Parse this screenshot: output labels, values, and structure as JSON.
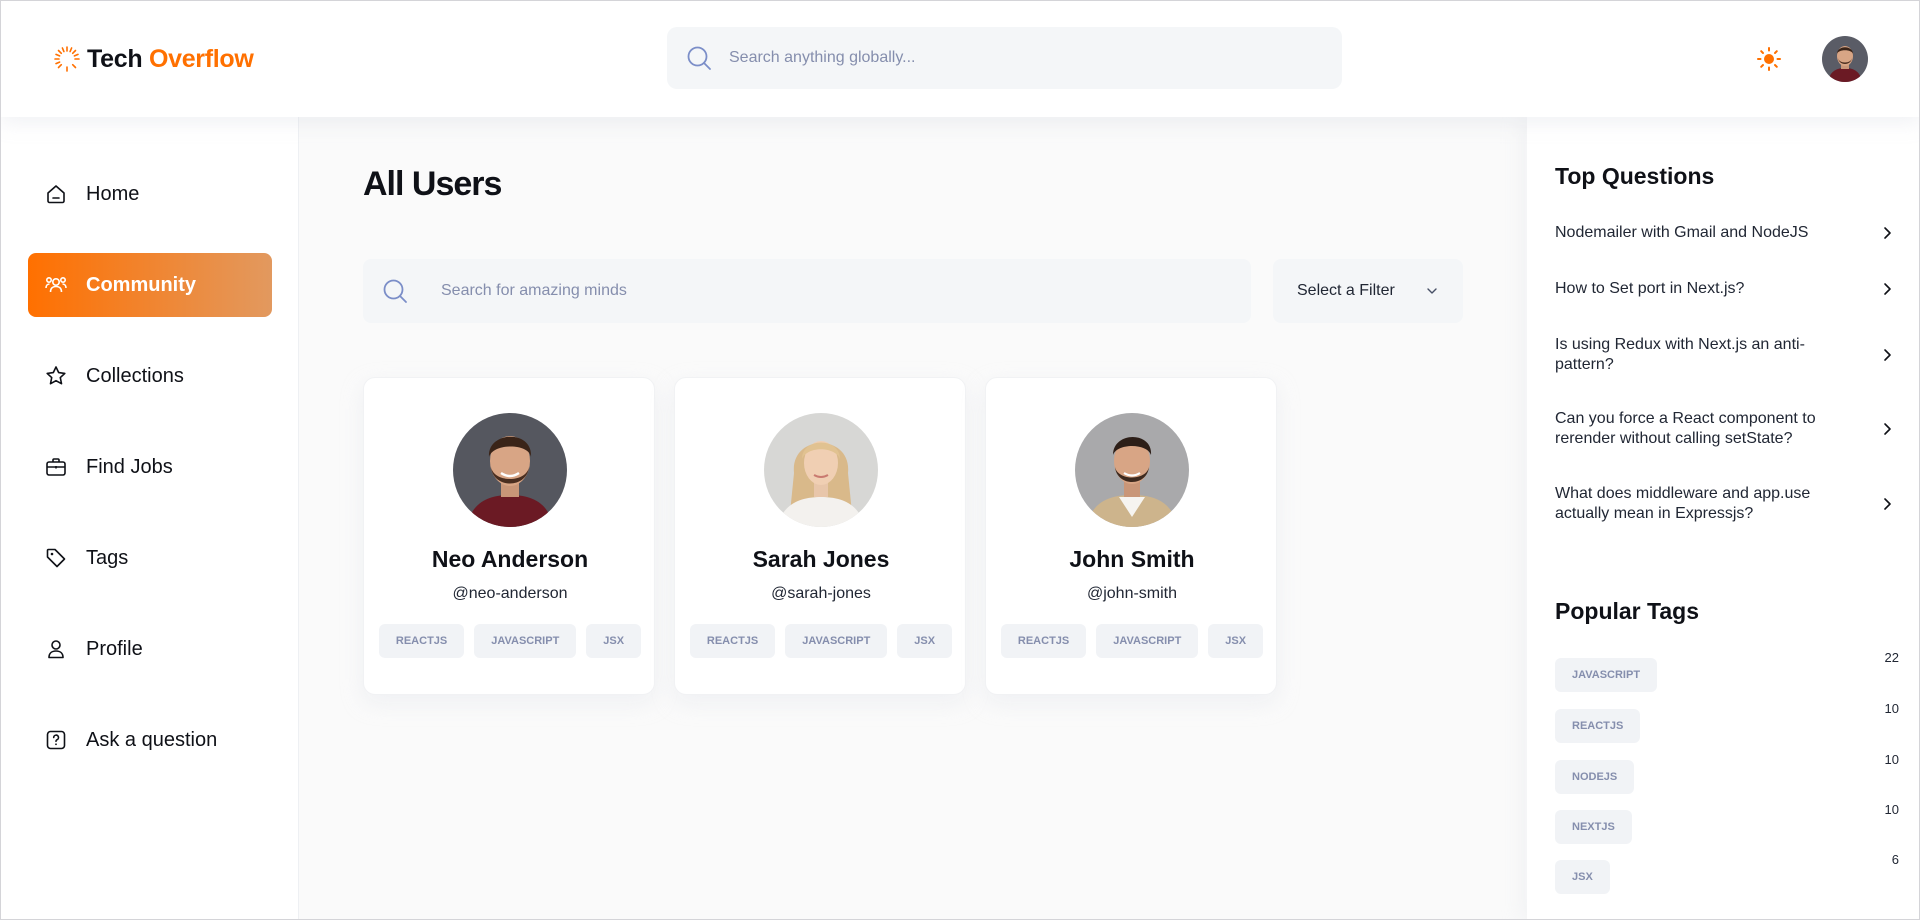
{
  "header": {
    "brand_part1": "Tech",
    "brand_part2": "Overflow",
    "search_placeholder": "Search anything globally...",
    "theme_icon": "sun-icon",
    "accent_color": "#ff7000"
  },
  "sidebar": {
    "items": [
      {
        "label": "Home",
        "icon": "home-icon",
        "active": false
      },
      {
        "label": "Community",
        "icon": "users-icon",
        "active": true
      },
      {
        "label": "Collections",
        "icon": "star-icon",
        "active": false
      },
      {
        "label": "Find Jobs",
        "icon": "suitcase-icon",
        "active": false
      },
      {
        "label": "Tags",
        "icon": "tag-icon",
        "active": false
      },
      {
        "label": "Profile",
        "icon": "user-icon",
        "active": false
      },
      {
        "label": "Ask a question",
        "icon": "question-icon",
        "active": false
      }
    ]
  },
  "main": {
    "title": "All Users",
    "search_placeholder": "Search for amazing minds",
    "filter_label": "Select a Filter",
    "users": [
      {
        "name": "Neo Anderson",
        "handle": "@neo-anderson",
        "tags": [
          "REACTJS",
          "JAVASCRIPT",
          "JSX"
        ]
      },
      {
        "name": "Sarah Jones",
        "handle": "@sarah-jones",
        "tags": [
          "REACTJS",
          "JAVASCRIPT",
          "JSX"
        ]
      },
      {
        "name": "John Smith",
        "handle": "@john-smith",
        "tags": [
          "REACTJS",
          "JAVASCRIPT",
          "JSX"
        ]
      }
    ]
  },
  "right_sidebar": {
    "top_questions_title": "Top Questions",
    "questions": [
      "Nodemailer with Gmail and NodeJS",
      "How to Set port in Next.js?",
      "Is using Redux with Next.js an anti-pattern?",
      "Can you force a React component to rerender without calling setState?",
      "What does middleware and app.use actually mean in Expressjs?"
    ],
    "popular_tags_title": "Popular Tags",
    "tags": [
      {
        "name": "JAVASCRIPT",
        "count": "22"
      },
      {
        "name": "REACTJS",
        "count": "10"
      },
      {
        "name": "NODEJS",
        "count": "10"
      },
      {
        "name": "NEXTJS",
        "count": "10"
      },
      {
        "name": "JSX",
        "count": "6"
      }
    ]
  }
}
